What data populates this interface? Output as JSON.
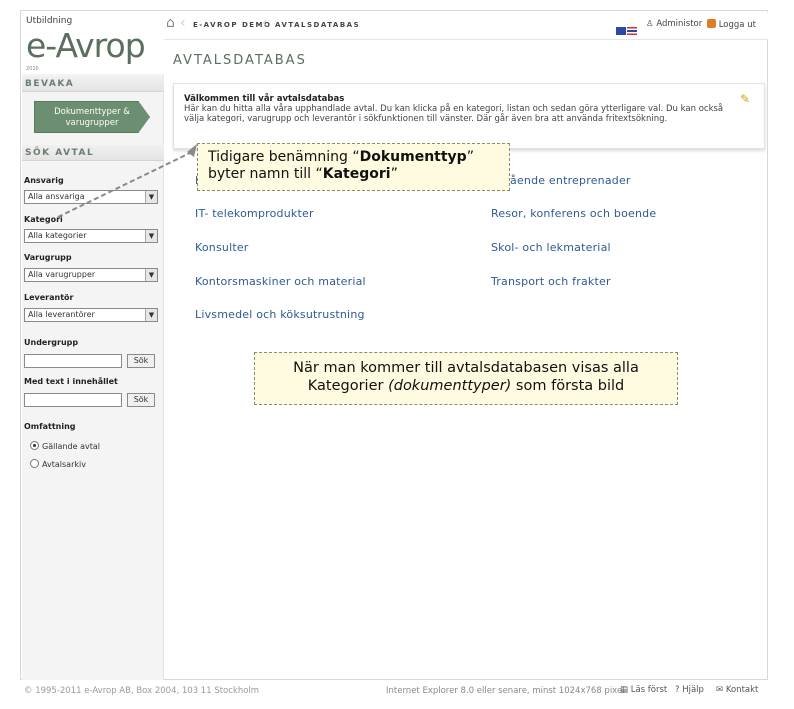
{
  "logo": {
    "small_text": "Utbildning",
    "brand": "e-Avrop",
    "tagline": "2010"
  },
  "sidebar": {
    "section_bevaka": "BEVAKA",
    "doc_button": [
      "Dokumenttyper &",
      "varugrupper"
    ],
    "section_sok": "SÖK AVTAL",
    "filters": {
      "ansvarig_label": "Ansvarig",
      "ansvarig_value": "Alla ansvariga",
      "kategori_label": "Kategori",
      "kategori_value": "Alla kategorier",
      "varugrupp_label": "Varugrupp",
      "varugrupp_value": "Alla varugrupper",
      "leverantor_label": "Leverantör",
      "leverantor_value": "Alla leverantörer",
      "undergrupp_label": "Undergrupp",
      "undergrupp_btn": "Sök",
      "fritext_label": "Med text i innehållet",
      "fritext_btn": "Sök",
      "omfattning_label": "Omfattning",
      "radio_1": "Gällande avtal",
      "radio_2": "Avtalsarkiv"
    }
  },
  "topbar": {
    "crumb_1": "E-AVROP DEMO",
    "crumb_2": "AVTALSDATABAS",
    "admin": "Administor",
    "logout": "Logga ut"
  },
  "main": {
    "title": "AVTALSDATABAS",
    "welcome_title": "Välkommen till vår avtalsdatabas",
    "welcome_text": "Här kan du hitta alla våra upphandlade avtal. Du kan klicka på en kategori, listan och sedan göra ytterligare val. Du kan också välja kategori, varugrupp och leverantör i sökfunktionen till vänster. Där går även bra att använda fritextsökning.",
    "categories_left": [
      "Fö",
      "IT- telekomprodukter",
      "Konsulter",
      "Kontorsmaskiner och material",
      "Livsmedel och köksutrustning"
    ],
    "categories_right": [
      "ående entreprenader",
      "Resor, konferens och boende",
      "Skol- och lekmaterial",
      "Transport och frakter"
    ]
  },
  "callouts": {
    "c1_line1_pre": "Tidigare benämning “",
    "c1_line1_bold": "Dokumenttyp",
    "c1_line1_post": "”",
    "c1_line2_pre": "byter namn till “",
    "c1_line2_bold": "Kategori",
    "c1_line2_post": "”",
    "c2_line1": "När man kommer till avtalsdatabasen visas alla",
    "c2_line2_pre": "Kategorier ",
    "c2_line2_italic": "(dokumenttyper)",
    "c2_line2_post": " som första bild"
  },
  "footer": {
    "copyright": "© 1995-2011 e-Avrop AB, Box 2004, 103 11 Stockholm",
    "browser": "Internet Explorer 8.0 eller senare, minst 1024x768 pixel",
    "link_1": "Läs först",
    "link_2": "Hjälp",
    "link_3": "Kontakt"
  },
  "colors": {
    "accent_green": "#6b8f70",
    "link_blue": "#2f5a93",
    "callout_bg": "#fffbe0"
  }
}
